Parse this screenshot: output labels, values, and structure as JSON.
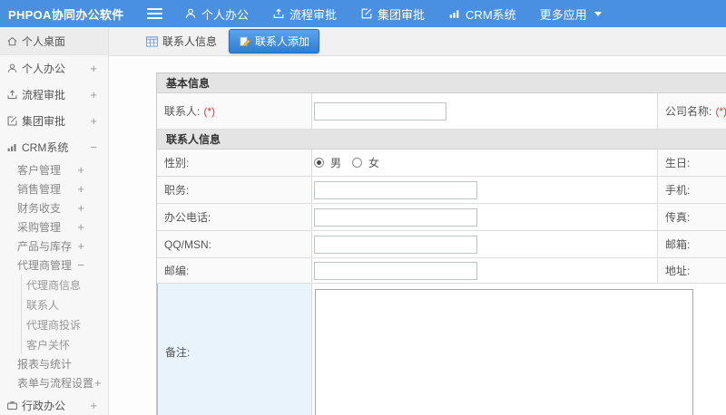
{
  "topbar": {
    "brand": "PHPOA协同办公软件",
    "nav": [
      {
        "label": "个人办公",
        "icon": "user-icon"
      },
      {
        "label": "流程审批",
        "icon": "workflow-icon"
      },
      {
        "label": "集团审批",
        "icon": "edit-square-icon"
      },
      {
        "label": "CRM系统",
        "icon": "bar-chart-icon"
      },
      {
        "label": "更多应用",
        "icon": "caret-down-icon"
      }
    ]
  },
  "sidebar": {
    "items": [
      {
        "label": "个人桌面",
        "level": "top",
        "icon": "home-icon",
        "expand": ""
      },
      {
        "label": "个人办公",
        "level": "top",
        "icon": "user-icon",
        "expand": "+"
      },
      {
        "label": "流程审批",
        "level": "top",
        "icon": "workflow-icon",
        "expand": "+"
      },
      {
        "label": "集团审批",
        "level": "top",
        "icon": "edit-square-icon",
        "expand": "+"
      },
      {
        "label": "CRM系统",
        "level": "top",
        "icon": "bar-chart-icon",
        "expand": "−"
      },
      {
        "label": "客户管理",
        "level": "sub",
        "expand": "+"
      },
      {
        "label": "销售管理",
        "level": "sub",
        "expand": "+"
      },
      {
        "label": "财务收支",
        "level": "sub",
        "expand": "+"
      },
      {
        "label": "采购管理",
        "level": "sub",
        "expand": "+"
      },
      {
        "label": "产品与库存",
        "level": "sub",
        "expand": "+"
      },
      {
        "label": "代理商管理",
        "level": "sub",
        "expand": "−"
      },
      {
        "label": "代理商信息",
        "level": "sub2",
        "expand": ""
      },
      {
        "label": "联系人",
        "level": "sub2",
        "expand": ""
      },
      {
        "label": "代理商投诉",
        "level": "sub2",
        "expand": ""
      },
      {
        "label": "客户关怀",
        "level": "sub2",
        "expand": ""
      },
      {
        "label": "报表与统计",
        "level": "sub",
        "expand": ""
      },
      {
        "label": "表单与流程设置",
        "level": "sub",
        "expand": "+"
      },
      {
        "label": "行政办公",
        "level": "top",
        "icon": "briefcase-icon",
        "expand": "+"
      }
    ]
  },
  "tabs": [
    {
      "label": "联系人信息",
      "active": false,
      "icon": "table-icon"
    },
    {
      "label": "联系人添加",
      "active": true,
      "icon": "pencil-icon"
    }
  ],
  "form": {
    "sections": {
      "basic": "基本信息",
      "contact": "联系人信息"
    },
    "required_mark": "(*)",
    "fields": {
      "contact_name": {
        "label": "联系人:",
        "required": true,
        "value": "",
        "right_label": "公司名称:",
        "right_required": true
      },
      "gender": {
        "label": "性别:",
        "option_male": "男",
        "option_female": "女",
        "selected": "男",
        "right_label": "生日:"
      },
      "job_title": {
        "label": "职务:",
        "value": "",
        "right_label": "手机:"
      },
      "office_phone": {
        "label": "办公电话:",
        "value": "",
        "right_label": "传真:"
      },
      "qq_msn": {
        "label": "QQ/MSN:",
        "value": "",
        "right_label": "邮箱:"
      },
      "zip_code": {
        "label": "邮编:",
        "value": "",
        "right_label": "地址:"
      },
      "remark": {
        "label": "备注:",
        "value": ""
      }
    }
  },
  "colors": {
    "topbar_bg": "#4a90e2",
    "active_tab_bg": "#2f7ed2",
    "required_mark": "#e23b3b",
    "remark_label_bg": "#e9f3fc",
    "section_header_bg": "#e4e4e4"
  }
}
